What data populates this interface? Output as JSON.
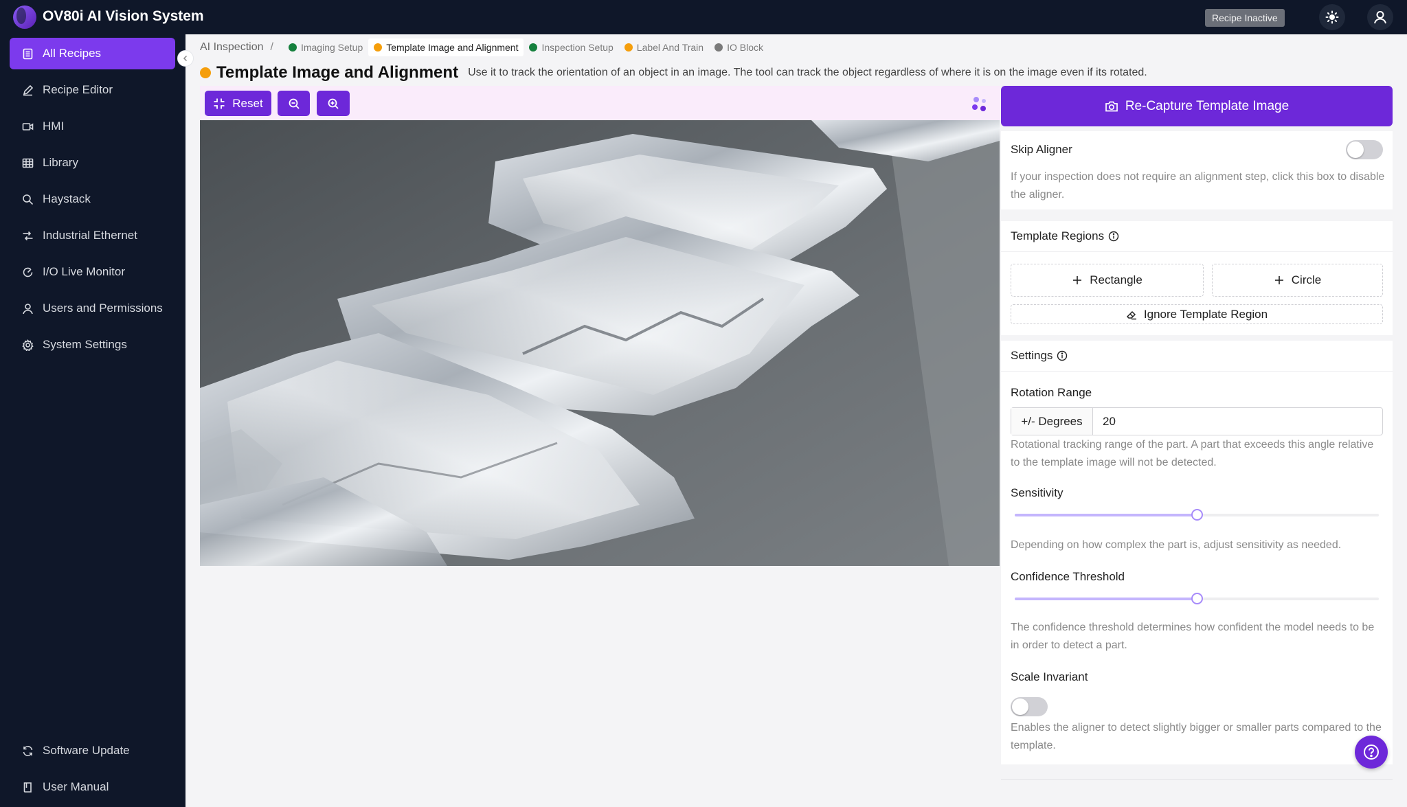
{
  "app": {
    "title": "OV80i AI Vision System",
    "recipe_status": "Recipe Inactive"
  },
  "sidebar": {
    "items": [
      {
        "label": "All Recipes",
        "icon": "recipes-list-icon",
        "active": true
      },
      {
        "label": "Recipe Editor",
        "icon": "pencil-icon"
      },
      {
        "label": "HMI",
        "icon": "video-icon"
      },
      {
        "label": "Library",
        "icon": "grid-icon"
      },
      {
        "label": "Haystack",
        "icon": "search-icon"
      },
      {
        "label": "Industrial Ethernet",
        "icon": "network-icon"
      },
      {
        "label": "I/O Live Monitor",
        "icon": "gauge-icon"
      },
      {
        "label": "Users and Permissions",
        "icon": "user-icon"
      },
      {
        "label": "System Settings",
        "icon": "gear-icon"
      }
    ],
    "bottom": [
      {
        "label": "Software Update",
        "icon": "refresh-icon"
      },
      {
        "label": "User Manual",
        "icon": "book-icon"
      }
    ]
  },
  "breadcrumb": {
    "root": "AI Inspection",
    "sep": "/",
    "steps": [
      {
        "label": "Imaging Setup",
        "color": "#15803d"
      },
      {
        "label": "Template Image and Alignment",
        "color": "#f59e0b",
        "active": true
      },
      {
        "label": "Inspection Setup",
        "color": "#15803d"
      },
      {
        "label": "Label And Train",
        "color": "#f59e0b"
      },
      {
        "label": "IO Block",
        "color": "#7a7a7a"
      }
    ]
  },
  "header": {
    "title": "Template Image and Alignment",
    "description": "Use it to track the orientation of an object in an image. The tool can track the object regardless of where it is on the image even if its rotated.",
    "status_color": "#f59e0b"
  },
  "toolbar": {
    "reset_label": "Reset"
  },
  "panel": {
    "recapture_label": "Re-Capture Template Image",
    "skip_aligner": {
      "label": "Skip Aligner",
      "enabled": false,
      "help": "If your inspection does not require an alignment step, click this box to disable the aligner."
    },
    "template_regions": {
      "title": "Template Regions",
      "rectangle_label": "Rectangle",
      "circle_label": "Circle",
      "ignore_label": "Ignore Template Region"
    },
    "settings": {
      "title": "Settings",
      "rotation": {
        "label": "Rotation Range",
        "unit": "+/- Degrees",
        "value": "20",
        "help": "Rotational tracking range of the part. A part that exceeds this angle relative to the template image will not be detected."
      },
      "sensitivity": {
        "label": "Sensitivity",
        "value": 0.5,
        "help": "Depending on how complex the part is, adjust sensitivity as needed."
      },
      "confidence": {
        "label": "Confidence Threshold",
        "value": 0.5,
        "help": "The confidence threshold determines how confident the model needs to be in order to detect a part."
      },
      "scale_invariant": {
        "label": "Scale Invariant",
        "enabled": false,
        "help": "Enables the aligner to detect slightly bigger or smaller parts compared to the template."
      }
    }
  },
  "colors": {
    "accent": "#6d28d9",
    "nav_bg": "#0f1729",
    "toolbar_bg": "#faecfb"
  }
}
